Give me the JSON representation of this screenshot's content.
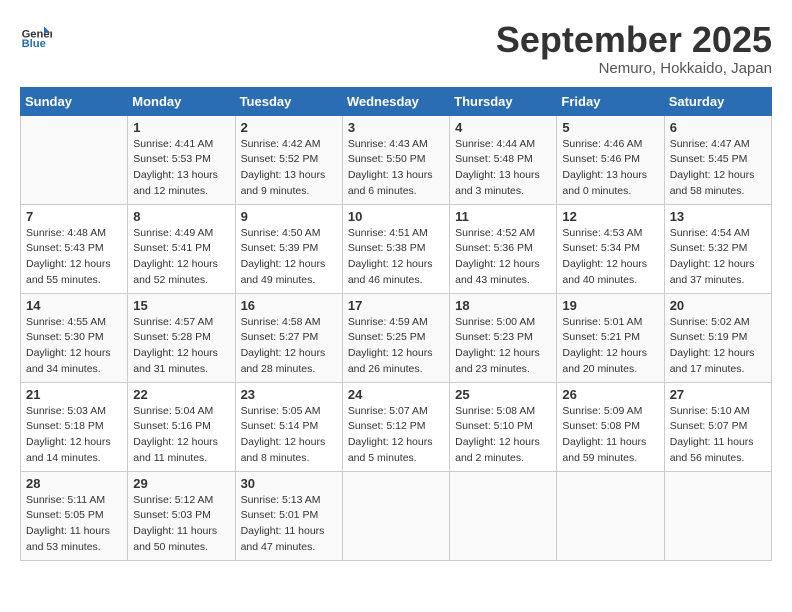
{
  "header": {
    "logo_general": "General",
    "logo_blue": "Blue",
    "month_title": "September 2025",
    "location": "Nemuro, Hokkaido, Japan"
  },
  "weekdays": [
    "Sunday",
    "Monday",
    "Tuesday",
    "Wednesday",
    "Thursday",
    "Friday",
    "Saturday"
  ],
  "weeks": [
    [
      {
        "day": "",
        "info": ""
      },
      {
        "day": "1",
        "info": "Sunrise: 4:41 AM\nSunset: 5:53 PM\nDaylight: 13 hours\nand 12 minutes."
      },
      {
        "day": "2",
        "info": "Sunrise: 4:42 AM\nSunset: 5:52 PM\nDaylight: 13 hours\nand 9 minutes."
      },
      {
        "day": "3",
        "info": "Sunrise: 4:43 AM\nSunset: 5:50 PM\nDaylight: 13 hours\nand 6 minutes."
      },
      {
        "day": "4",
        "info": "Sunrise: 4:44 AM\nSunset: 5:48 PM\nDaylight: 13 hours\nand 3 minutes."
      },
      {
        "day": "5",
        "info": "Sunrise: 4:46 AM\nSunset: 5:46 PM\nDaylight: 13 hours\nand 0 minutes."
      },
      {
        "day": "6",
        "info": "Sunrise: 4:47 AM\nSunset: 5:45 PM\nDaylight: 12 hours\nand 58 minutes."
      }
    ],
    [
      {
        "day": "7",
        "info": "Sunrise: 4:48 AM\nSunset: 5:43 PM\nDaylight: 12 hours\nand 55 minutes."
      },
      {
        "day": "8",
        "info": "Sunrise: 4:49 AM\nSunset: 5:41 PM\nDaylight: 12 hours\nand 52 minutes."
      },
      {
        "day": "9",
        "info": "Sunrise: 4:50 AM\nSunset: 5:39 PM\nDaylight: 12 hours\nand 49 minutes."
      },
      {
        "day": "10",
        "info": "Sunrise: 4:51 AM\nSunset: 5:38 PM\nDaylight: 12 hours\nand 46 minutes."
      },
      {
        "day": "11",
        "info": "Sunrise: 4:52 AM\nSunset: 5:36 PM\nDaylight: 12 hours\nand 43 minutes."
      },
      {
        "day": "12",
        "info": "Sunrise: 4:53 AM\nSunset: 5:34 PM\nDaylight: 12 hours\nand 40 minutes."
      },
      {
        "day": "13",
        "info": "Sunrise: 4:54 AM\nSunset: 5:32 PM\nDaylight: 12 hours\nand 37 minutes."
      }
    ],
    [
      {
        "day": "14",
        "info": "Sunrise: 4:55 AM\nSunset: 5:30 PM\nDaylight: 12 hours\nand 34 minutes."
      },
      {
        "day": "15",
        "info": "Sunrise: 4:57 AM\nSunset: 5:28 PM\nDaylight: 12 hours\nand 31 minutes."
      },
      {
        "day": "16",
        "info": "Sunrise: 4:58 AM\nSunset: 5:27 PM\nDaylight: 12 hours\nand 28 minutes."
      },
      {
        "day": "17",
        "info": "Sunrise: 4:59 AM\nSunset: 5:25 PM\nDaylight: 12 hours\nand 26 minutes."
      },
      {
        "day": "18",
        "info": "Sunrise: 5:00 AM\nSunset: 5:23 PM\nDaylight: 12 hours\nand 23 minutes."
      },
      {
        "day": "19",
        "info": "Sunrise: 5:01 AM\nSunset: 5:21 PM\nDaylight: 12 hours\nand 20 minutes."
      },
      {
        "day": "20",
        "info": "Sunrise: 5:02 AM\nSunset: 5:19 PM\nDaylight: 12 hours\nand 17 minutes."
      }
    ],
    [
      {
        "day": "21",
        "info": "Sunrise: 5:03 AM\nSunset: 5:18 PM\nDaylight: 12 hours\nand 14 minutes."
      },
      {
        "day": "22",
        "info": "Sunrise: 5:04 AM\nSunset: 5:16 PM\nDaylight: 12 hours\nand 11 minutes."
      },
      {
        "day": "23",
        "info": "Sunrise: 5:05 AM\nSunset: 5:14 PM\nDaylight: 12 hours\nand 8 minutes."
      },
      {
        "day": "24",
        "info": "Sunrise: 5:07 AM\nSunset: 5:12 PM\nDaylight: 12 hours\nand 5 minutes."
      },
      {
        "day": "25",
        "info": "Sunrise: 5:08 AM\nSunset: 5:10 PM\nDaylight: 12 hours\nand 2 minutes."
      },
      {
        "day": "26",
        "info": "Sunrise: 5:09 AM\nSunset: 5:08 PM\nDaylight: 11 hours\nand 59 minutes."
      },
      {
        "day": "27",
        "info": "Sunrise: 5:10 AM\nSunset: 5:07 PM\nDaylight: 11 hours\nand 56 minutes."
      }
    ],
    [
      {
        "day": "28",
        "info": "Sunrise: 5:11 AM\nSunset: 5:05 PM\nDaylight: 11 hours\nand 53 minutes."
      },
      {
        "day": "29",
        "info": "Sunrise: 5:12 AM\nSunset: 5:03 PM\nDaylight: 11 hours\nand 50 minutes."
      },
      {
        "day": "30",
        "info": "Sunrise: 5:13 AM\nSunset: 5:01 PM\nDaylight: 11 hours\nand 47 minutes."
      },
      {
        "day": "",
        "info": ""
      },
      {
        "day": "",
        "info": ""
      },
      {
        "day": "",
        "info": ""
      },
      {
        "day": "",
        "info": ""
      }
    ]
  ]
}
